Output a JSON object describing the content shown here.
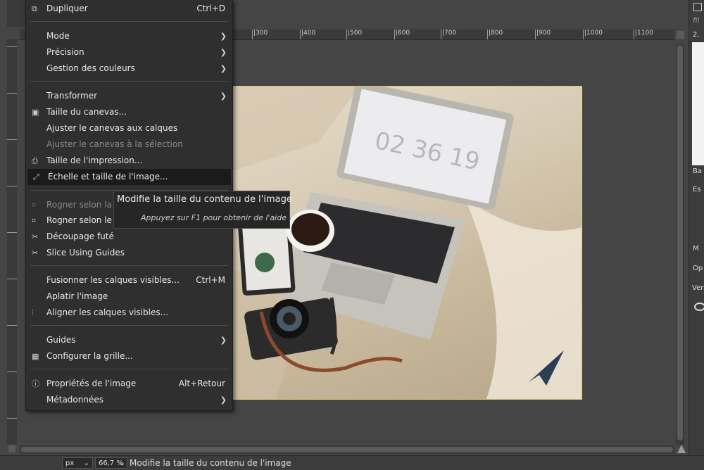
{
  "menu": {
    "items": [
      {
        "label": "Dupliquer",
        "shortcut": "Ctrl+D",
        "icon": "duplicate-icon",
        "submenu": false,
        "disabled": false
      },
      {
        "label": "Mode",
        "shortcut": "",
        "icon": "",
        "submenu": true,
        "disabled": false
      },
      {
        "label": "Précision",
        "shortcut": "",
        "icon": "",
        "submenu": true,
        "disabled": false
      },
      {
        "label": "Gestion des couleurs",
        "shortcut": "",
        "icon": "",
        "submenu": true,
        "disabled": false
      },
      {
        "label": "Transformer",
        "shortcut": "",
        "icon": "",
        "submenu": true,
        "disabled": false
      },
      {
        "label": "Taille du canevas...",
        "shortcut": "",
        "icon": "canvas-size-icon",
        "submenu": false,
        "disabled": false
      },
      {
        "label": "Ajuster le canevas aux calques",
        "shortcut": "",
        "icon": "",
        "submenu": false,
        "disabled": false
      },
      {
        "label": "Ajuster le canevas à la sélection",
        "shortcut": "",
        "icon": "",
        "submenu": false,
        "disabled": true
      },
      {
        "label": "Taille de l'impression...",
        "shortcut": "",
        "icon": "printer-icon",
        "submenu": false,
        "disabled": false
      },
      {
        "label": "Échelle et taille de l'image...",
        "shortcut": "",
        "icon": "scale-image-icon",
        "submenu": false,
        "disabled": false,
        "highlighted": true
      },
      {
        "label": "Rogner selon la sé",
        "shortcut": "",
        "icon": "crop-icon",
        "submenu": false,
        "disabled": true
      },
      {
        "label": "Rogner selon le co",
        "shortcut": "",
        "icon": "crop-content-icon",
        "submenu": false,
        "disabled": false
      },
      {
        "label": "Découpage futé",
        "shortcut": "",
        "icon": "guillotine-icon",
        "submenu": false,
        "disabled": false
      },
      {
        "label": "Slice Using Guides",
        "shortcut": "",
        "icon": "slice-icon",
        "submenu": false,
        "disabled": false
      },
      {
        "label": "Fusionner les calques visibles...",
        "shortcut": "Ctrl+M",
        "icon": "",
        "submenu": false,
        "disabled": false
      },
      {
        "label": "Aplatir l'image",
        "shortcut": "",
        "icon": "",
        "submenu": false,
        "disabled": false
      },
      {
        "label": "Aligner les calques visibles...",
        "shortcut": "",
        "icon": "align-icon",
        "submenu": false,
        "disabled": false
      },
      {
        "label": "Guides",
        "shortcut": "",
        "icon": "",
        "submenu": true,
        "disabled": false
      },
      {
        "label": "Configurer la grille...",
        "shortcut": "",
        "icon": "grid-icon",
        "submenu": false,
        "disabled": false
      },
      {
        "label": "Propriétés de l'image",
        "shortcut": "Alt+Retour",
        "icon": "info-icon",
        "submenu": false,
        "disabled": false
      },
      {
        "label": "Métadonnées",
        "shortcut": "",
        "icon": "",
        "submenu": true,
        "disabled": false
      }
    ]
  },
  "tooltip": {
    "title": "Modifie la taille du contenu de l'image",
    "hint": "Appuyez sur F1 pour obtenir de l'aide"
  },
  "ruler": {
    "ticks": [
      "|300",
      "|400",
      "|500",
      "|600",
      "|700",
      "|800",
      "|900",
      "|1000",
      "|1100"
    ]
  },
  "statusbar": {
    "unit": "px",
    "zoom": "66,7 %",
    "message": "Modifie la taille du contenu de l'image"
  },
  "image": {
    "clock_text": "02 36 19"
  },
  "dock": {
    "labels": [
      "fil",
      "2.",
      "Ba",
      "Es",
      "M",
      "Op",
      "Ver"
    ]
  },
  "colors": {
    "menu_bg": "#2f2f2f",
    "highlight_bg": "#1b1b1b",
    "selection_border": "#e6d84a"
  }
}
